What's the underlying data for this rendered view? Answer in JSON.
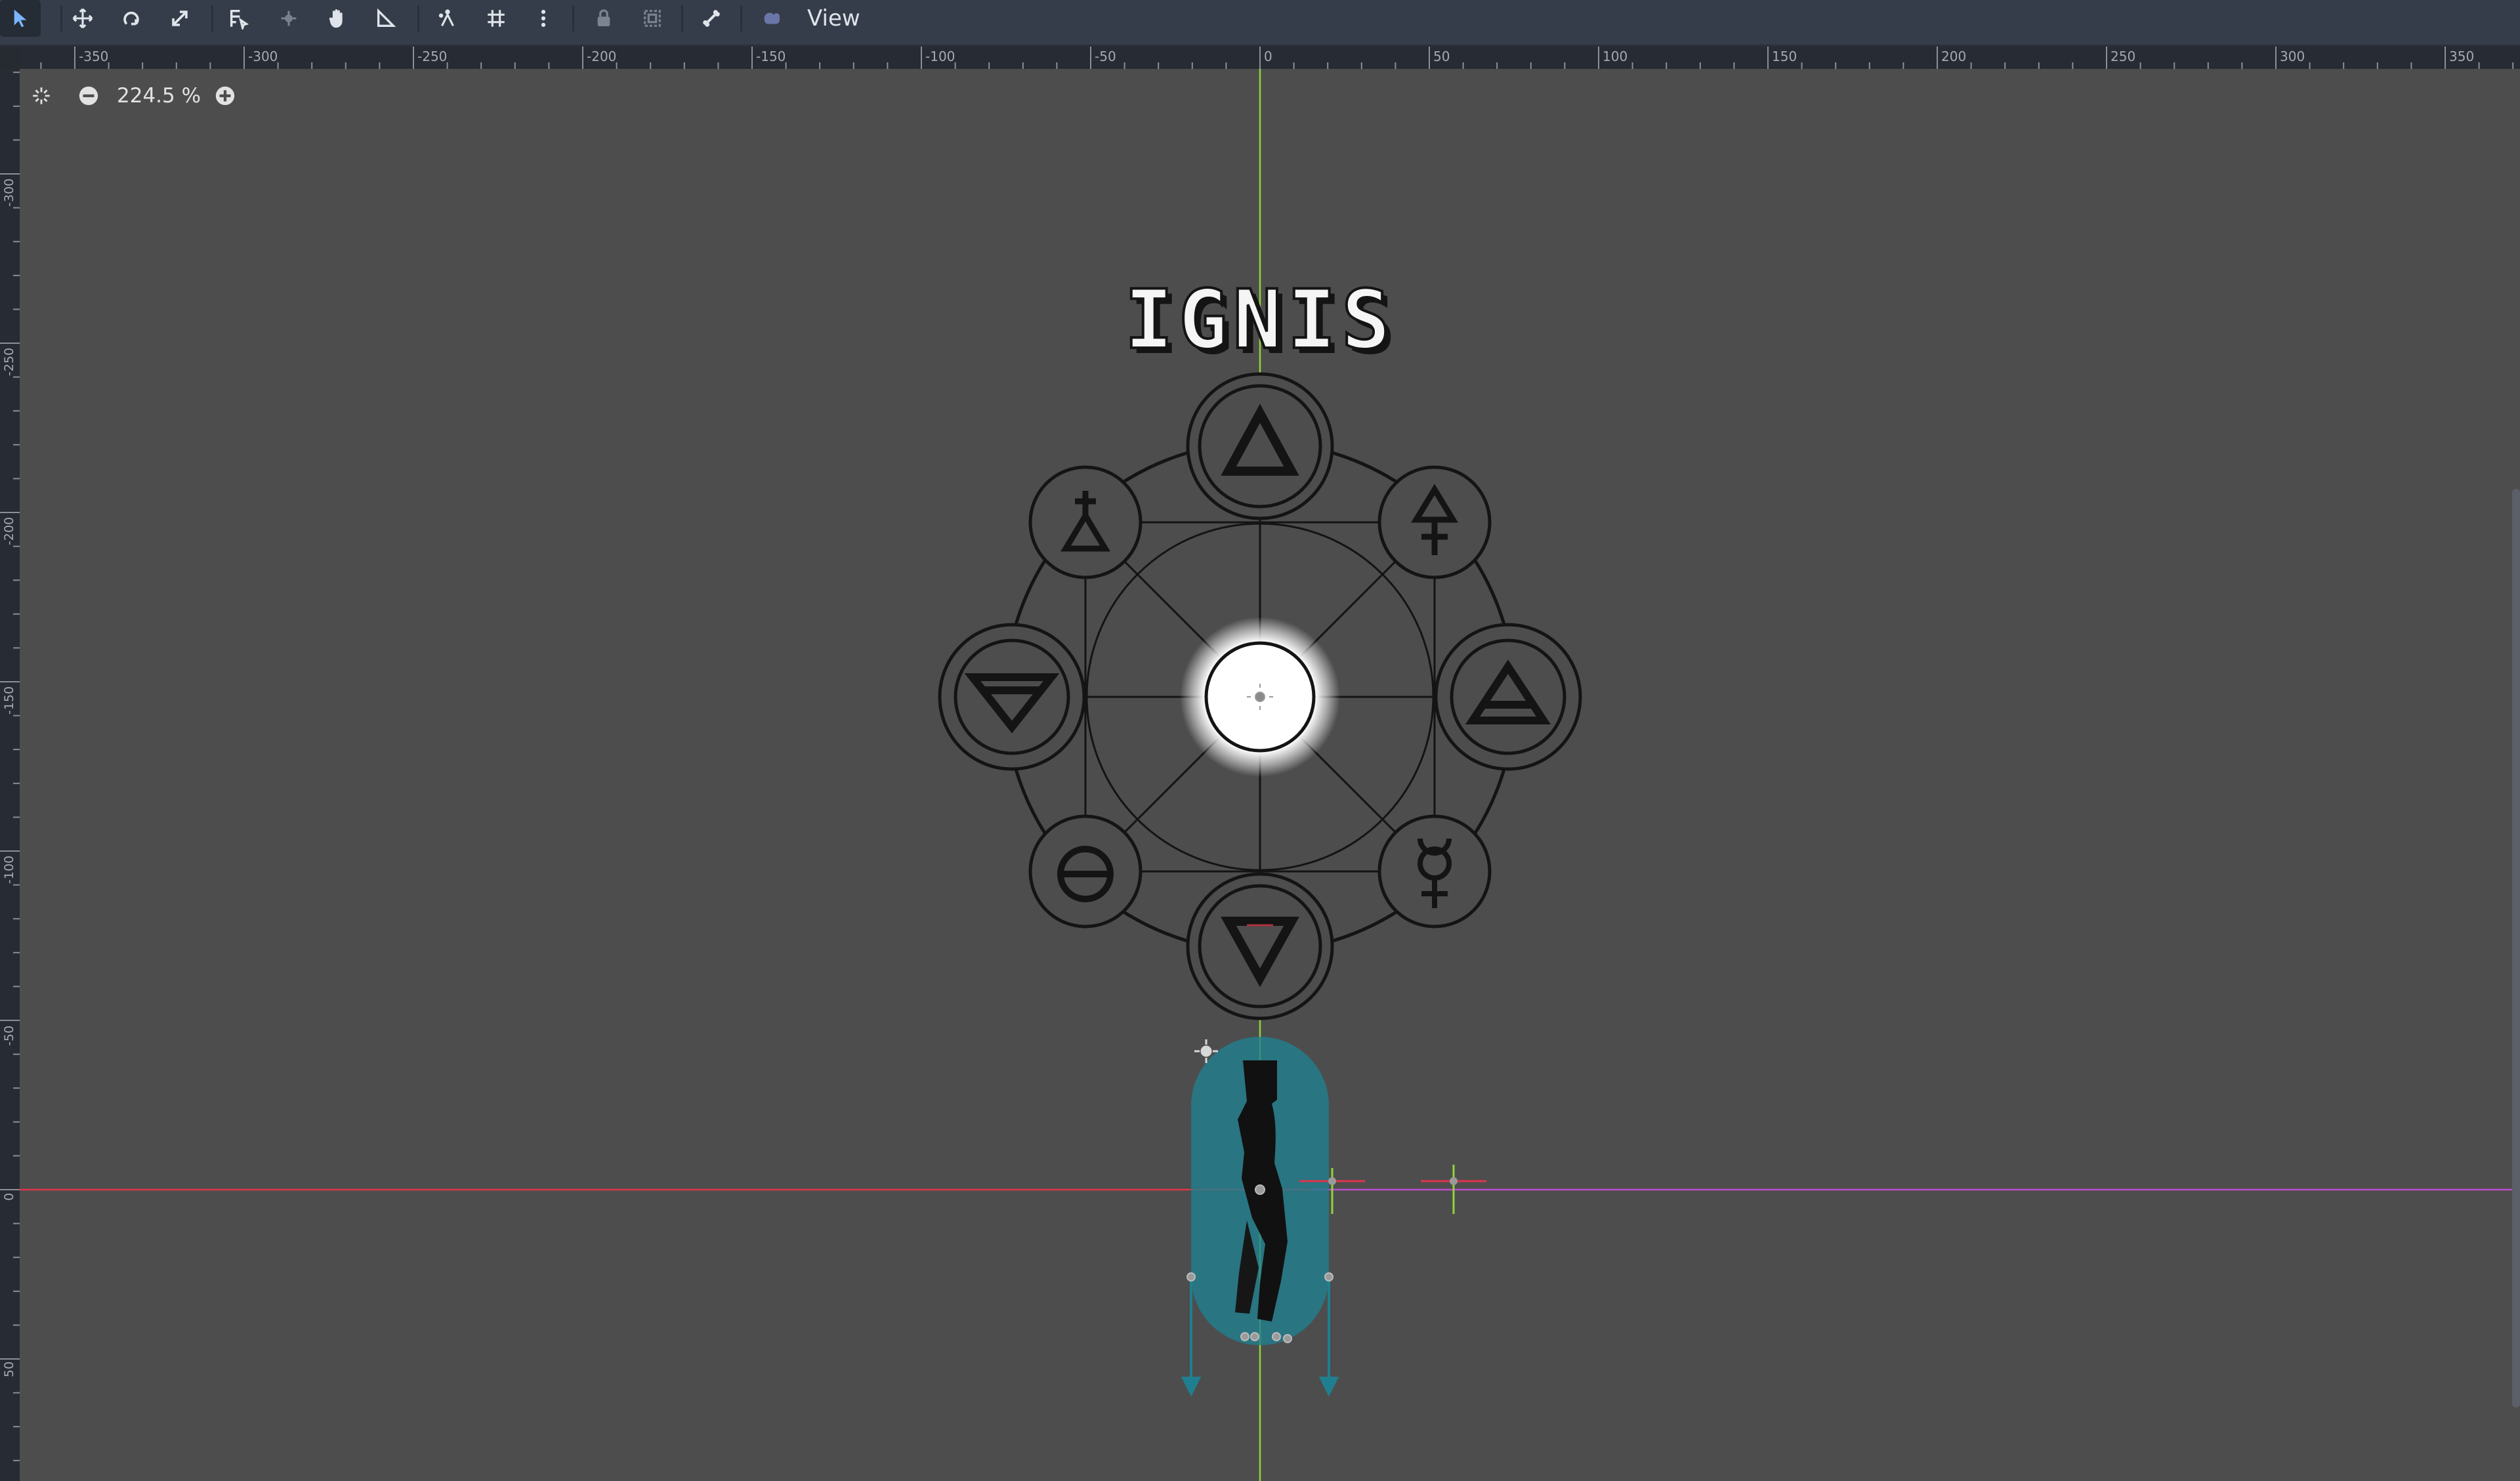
{
  "toolbar": {
    "tools": [
      {
        "name": "select-mode",
        "icon": "arrow-pointer-icon",
        "active": true
      },
      {
        "name": "move-mode",
        "icon": "move-arrows-icon"
      },
      {
        "name": "rotate-mode",
        "icon": "rotate-icon"
      },
      {
        "name": "scale-mode",
        "icon": "scale-icon"
      },
      {
        "name": "list-select",
        "icon": "list-select-icon"
      },
      {
        "name": "pivot-mode",
        "icon": "pivot-icon"
      },
      {
        "name": "pan-mode",
        "icon": "hand-icon"
      },
      {
        "name": "ruler-mode",
        "icon": "ruler-icon"
      },
      {
        "name": "smart-snap",
        "icon": "snap-icon"
      },
      {
        "name": "grid-snap",
        "icon": "grid-icon"
      },
      {
        "name": "snap-options",
        "icon": "kebab-icon"
      },
      {
        "name": "lock",
        "icon": "lock-icon"
      },
      {
        "name": "group",
        "icon": "group-icon"
      },
      {
        "name": "skeleton",
        "icon": "bone-icon"
      },
      {
        "name": "camera-override",
        "icon": "camera-icon"
      }
    ],
    "view_label": "View"
  },
  "ruler": {
    "horizontal_labels": [
      "-350",
      "-300",
      "-250",
      "-200",
      "-150",
      "-100",
      "-50",
      "0",
      "50",
      "100",
      "150",
      "200",
      "250",
      "300",
      "350"
    ],
    "vertical_labels": [
      "-300",
      "-250",
      "-200",
      "-150",
      "-100",
      "-50",
      "0",
      "50"
    ]
  },
  "zoom": {
    "value": "224.5 %",
    "center_icon": "zoom-reset-icon",
    "minus_icon": "zoom-out-icon",
    "plus_icon": "zoom-in-icon"
  },
  "scene": {
    "title_text": "IGNIS",
    "colors": {
      "viewport_bg": "#4d4d4d",
      "axis_x": "#e0354a",
      "axis_y": "#8fd43a",
      "collision_shape": "#1f8090",
      "circle_stroke": "#141414",
      "glow": "#ffffff"
    }
  }
}
